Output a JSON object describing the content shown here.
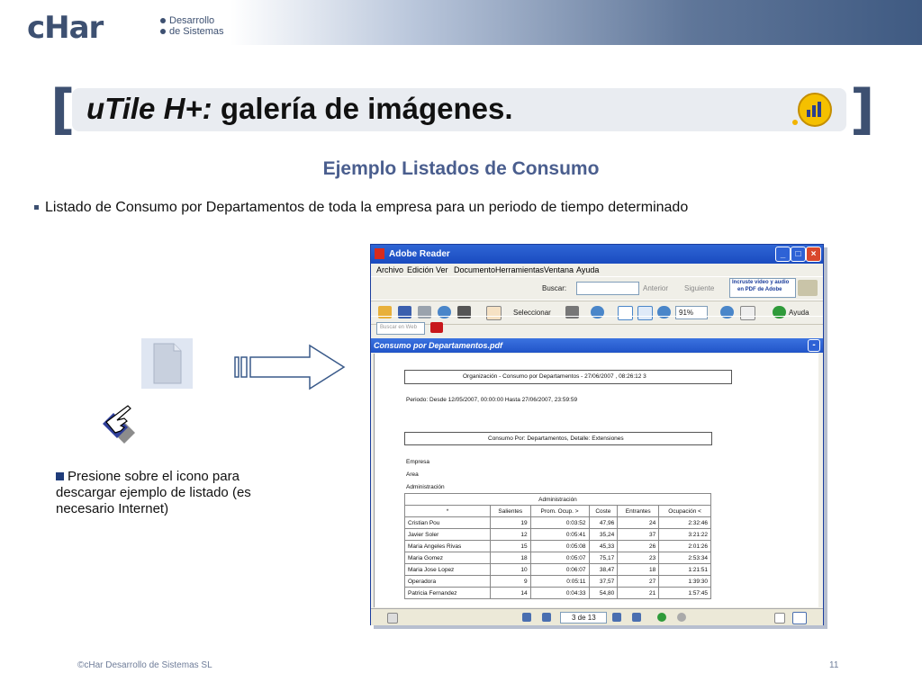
{
  "header": {
    "logo_text": "cHar",
    "logo_line1": "Desarrollo",
    "logo_line2": "de Sistemas"
  },
  "slide": {
    "title_italic": "uTile H+:",
    "title_rest": " galería de imágenes.",
    "subtitle": "Ejemplo Listados de Consumo",
    "bullet": "Listado de Consumo por Departamentos de toda la empresa para un periodo de tiempo determinado",
    "instruction": "Presione sobre el icono para descargar  ejemplo de listado (es necesario Internet)",
    "footer": "©cHar Desarrollo de Sistemas SL",
    "page_number": "11"
  },
  "window": {
    "title": "Adobe Reader",
    "menu": [
      "Archivo",
      "Edición",
      "Ver",
      "Documento",
      "Herramientas",
      "Ventana",
      "Ayuda"
    ],
    "toolbar": {
      "search_label": "Buscar:",
      "prev_label": "Anterior",
      "next_label": "Siguiente",
      "promo_line1": "Incruste video y audio",
      "promo_line2": "en PDF de Adobe",
      "select_label": "Seleccionar",
      "zoom_value": "91%",
      "help_label": "Ayuda",
      "web_search_placeholder": "Buscar en Web"
    },
    "document_title": "Consumo por Departamentos.pdf",
    "page_indicator": "3 de 13"
  },
  "report": {
    "header": "Organización - Consumo por Departamentos - 27/06/2007 , 08:26:12       3",
    "period": "Periodo: Desde 12/05/2007, 00:00:00 Hasta 27/06/2007, 23:59:59",
    "section": "Consumo Por: Departamentos, Detalle: Extensiones",
    "labels": [
      "Empresa",
      "Area",
      "Administración"
    ],
    "table_caption": "Administración",
    "columns": [
      "*",
      "Salientes",
      "Prom. Ocup. >",
      "Coste",
      "Entrantes",
      "Ocupación <"
    ],
    "rows": [
      [
        "Cristian Pou",
        "19",
        "0:03:52",
        "47,96",
        "24",
        "2:32:46"
      ],
      [
        "Javier Soler",
        "12",
        "0:05:41",
        "35,24",
        "37",
        "3:21:22"
      ],
      [
        "Maria Angeles Rivas",
        "15",
        "0:05:08",
        "45,33",
        "26",
        "2:01:26"
      ],
      [
        "Maria Gomez",
        "18",
        "0:05:07",
        "75,17",
        "23",
        "2:53:34"
      ],
      [
        "Maria Jose Lopez",
        "10",
        "0:06:07",
        "38,47",
        "18",
        "1:21:51"
      ],
      [
        "Operadora",
        "9",
        "0:05:11",
        "37,57",
        "27",
        "1:39:30"
      ],
      [
        "Patricia Fernandez",
        "14",
        "0:04:33",
        "54,80",
        "21",
        "1:57:45"
      ]
    ]
  }
}
